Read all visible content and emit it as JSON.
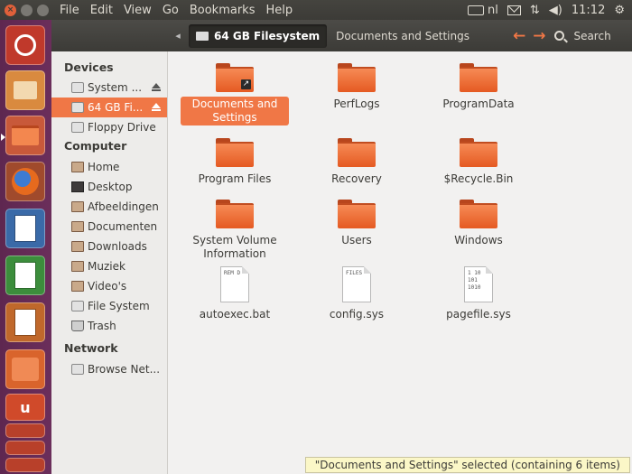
{
  "top_panel": {
    "menus": [
      "File",
      "Edit",
      "View",
      "Go",
      "Bookmarks",
      "Help"
    ],
    "keyboard_layout": "nl",
    "clock": "11:12"
  },
  "toolbar": {
    "back_arrow": "◂",
    "current_location": "64 GB Filesystem",
    "crumb": "Documents and Settings",
    "search_label": "Search"
  },
  "sidebar": {
    "devices_title": "Devices",
    "devices": [
      {
        "label": "System ...",
        "icon": "drive-icon",
        "eject": true
      },
      {
        "label": "64 GB Fi...",
        "icon": "drive-icon",
        "eject": true,
        "selected": true
      },
      {
        "label": "Floppy Drive",
        "icon": "floppy-icon",
        "eject": false
      }
    ],
    "computer_title": "Computer",
    "computer": [
      {
        "label": "Home",
        "icon": "home-folder-icon"
      },
      {
        "label": "Desktop",
        "icon": "desktop-icon"
      },
      {
        "label": "Afbeeldingen",
        "icon": "pictures-folder-icon"
      },
      {
        "label": "Documenten",
        "icon": "documents-folder-icon"
      },
      {
        "label": "Downloads",
        "icon": "downloads-folder-icon"
      },
      {
        "label": "Muziek",
        "icon": "music-folder-icon"
      },
      {
        "label": "Video's",
        "icon": "videos-folder-icon"
      },
      {
        "label": "File System",
        "icon": "filesystem-icon"
      },
      {
        "label": "Trash",
        "icon": "trash-icon"
      }
    ],
    "network_title": "Network",
    "network": [
      {
        "label": "Browse Net...",
        "icon": "network-icon"
      }
    ]
  },
  "main": {
    "items": [
      {
        "name": "Documents and Settings",
        "type": "folder-link",
        "selected": true
      },
      {
        "name": "PerfLogs",
        "type": "folder"
      },
      {
        "name": "ProgramData",
        "type": "folder"
      },
      {
        "name": "Program Files",
        "type": "folder"
      },
      {
        "name": "Recovery",
        "type": "folder"
      },
      {
        "name": "$Recycle.Bin",
        "type": "folder"
      },
      {
        "name": "System Volume Information",
        "type": "folder"
      },
      {
        "name": "Users",
        "type": "folder"
      },
      {
        "name": "Windows",
        "type": "folder"
      },
      {
        "name": "autoexec.bat",
        "type": "file",
        "preview": "REM D"
      },
      {
        "name": "config.sys",
        "type": "file",
        "preview": "FILES"
      },
      {
        "name": "pagefile.sys",
        "type": "file",
        "preview": "1 10 101 1010"
      }
    ]
  },
  "status": "\"Documents and Settings\" selected (containing 6 items)",
  "colors": {
    "accent": "#f07746",
    "launcher": "#5e2750",
    "panel": "#3c3b37"
  }
}
